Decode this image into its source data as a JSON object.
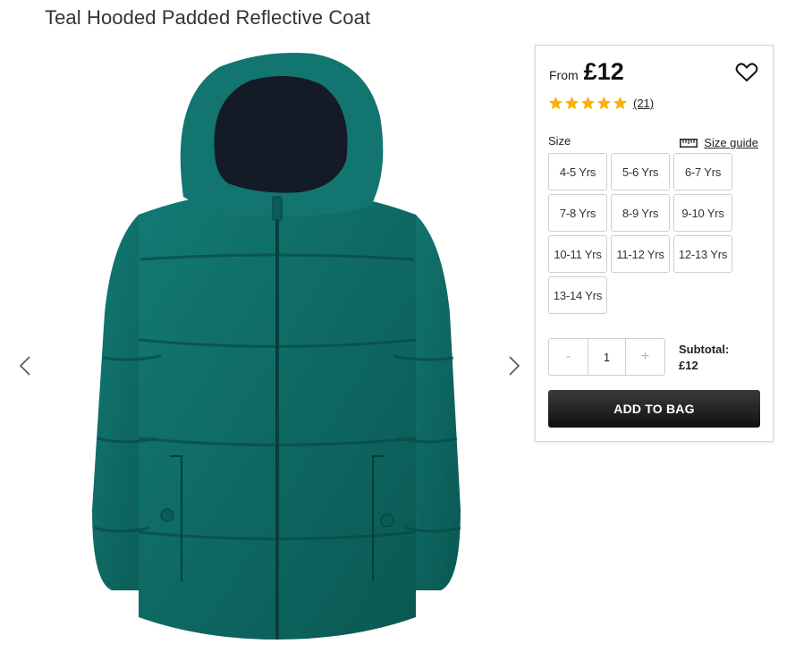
{
  "product": {
    "title": "Teal Hooded Padded Reflective Coat",
    "image_alt": "Teal hooded padded coat"
  },
  "gallery": {
    "prev_icon": "chevron-left-icon",
    "next_icon": "chevron-right-icon"
  },
  "purchase": {
    "price_prefix": "From",
    "price": "£12",
    "wishlist_icon": "heart-outline-icon",
    "rating": {
      "stars": 5,
      "max_stars": 5,
      "count": "(21)",
      "star_color": "#f5b301"
    },
    "size_label": "Size",
    "size_guide": {
      "icon": "ruler-icon",
      "label": "Size guide"
    },
    "sizes": [
      "4-5 Yrs",
      "5-6 Yrs",
      "6-7 Yrs",
      "7-8 Yrs",
      "8-9 Yrs",
      "9-10 Yrs",
      "10-11 Yrs",
      "11-12 Yrs",
      "12-13 Yrs",
      "13-14 Yrs"
    ],
    "quantity": {
      "decrement": "-",
      "value": "1",
      "increment": "+"
    },
    "subtotal_label": "Subtotal:",
    "subtotal_value": "£12",
    "add_to_bag": "ADD TO BAG"
  },
  "colors": {
    "coat": "#0f6b66",
    "button": "#1a1a1a"
  }
}
